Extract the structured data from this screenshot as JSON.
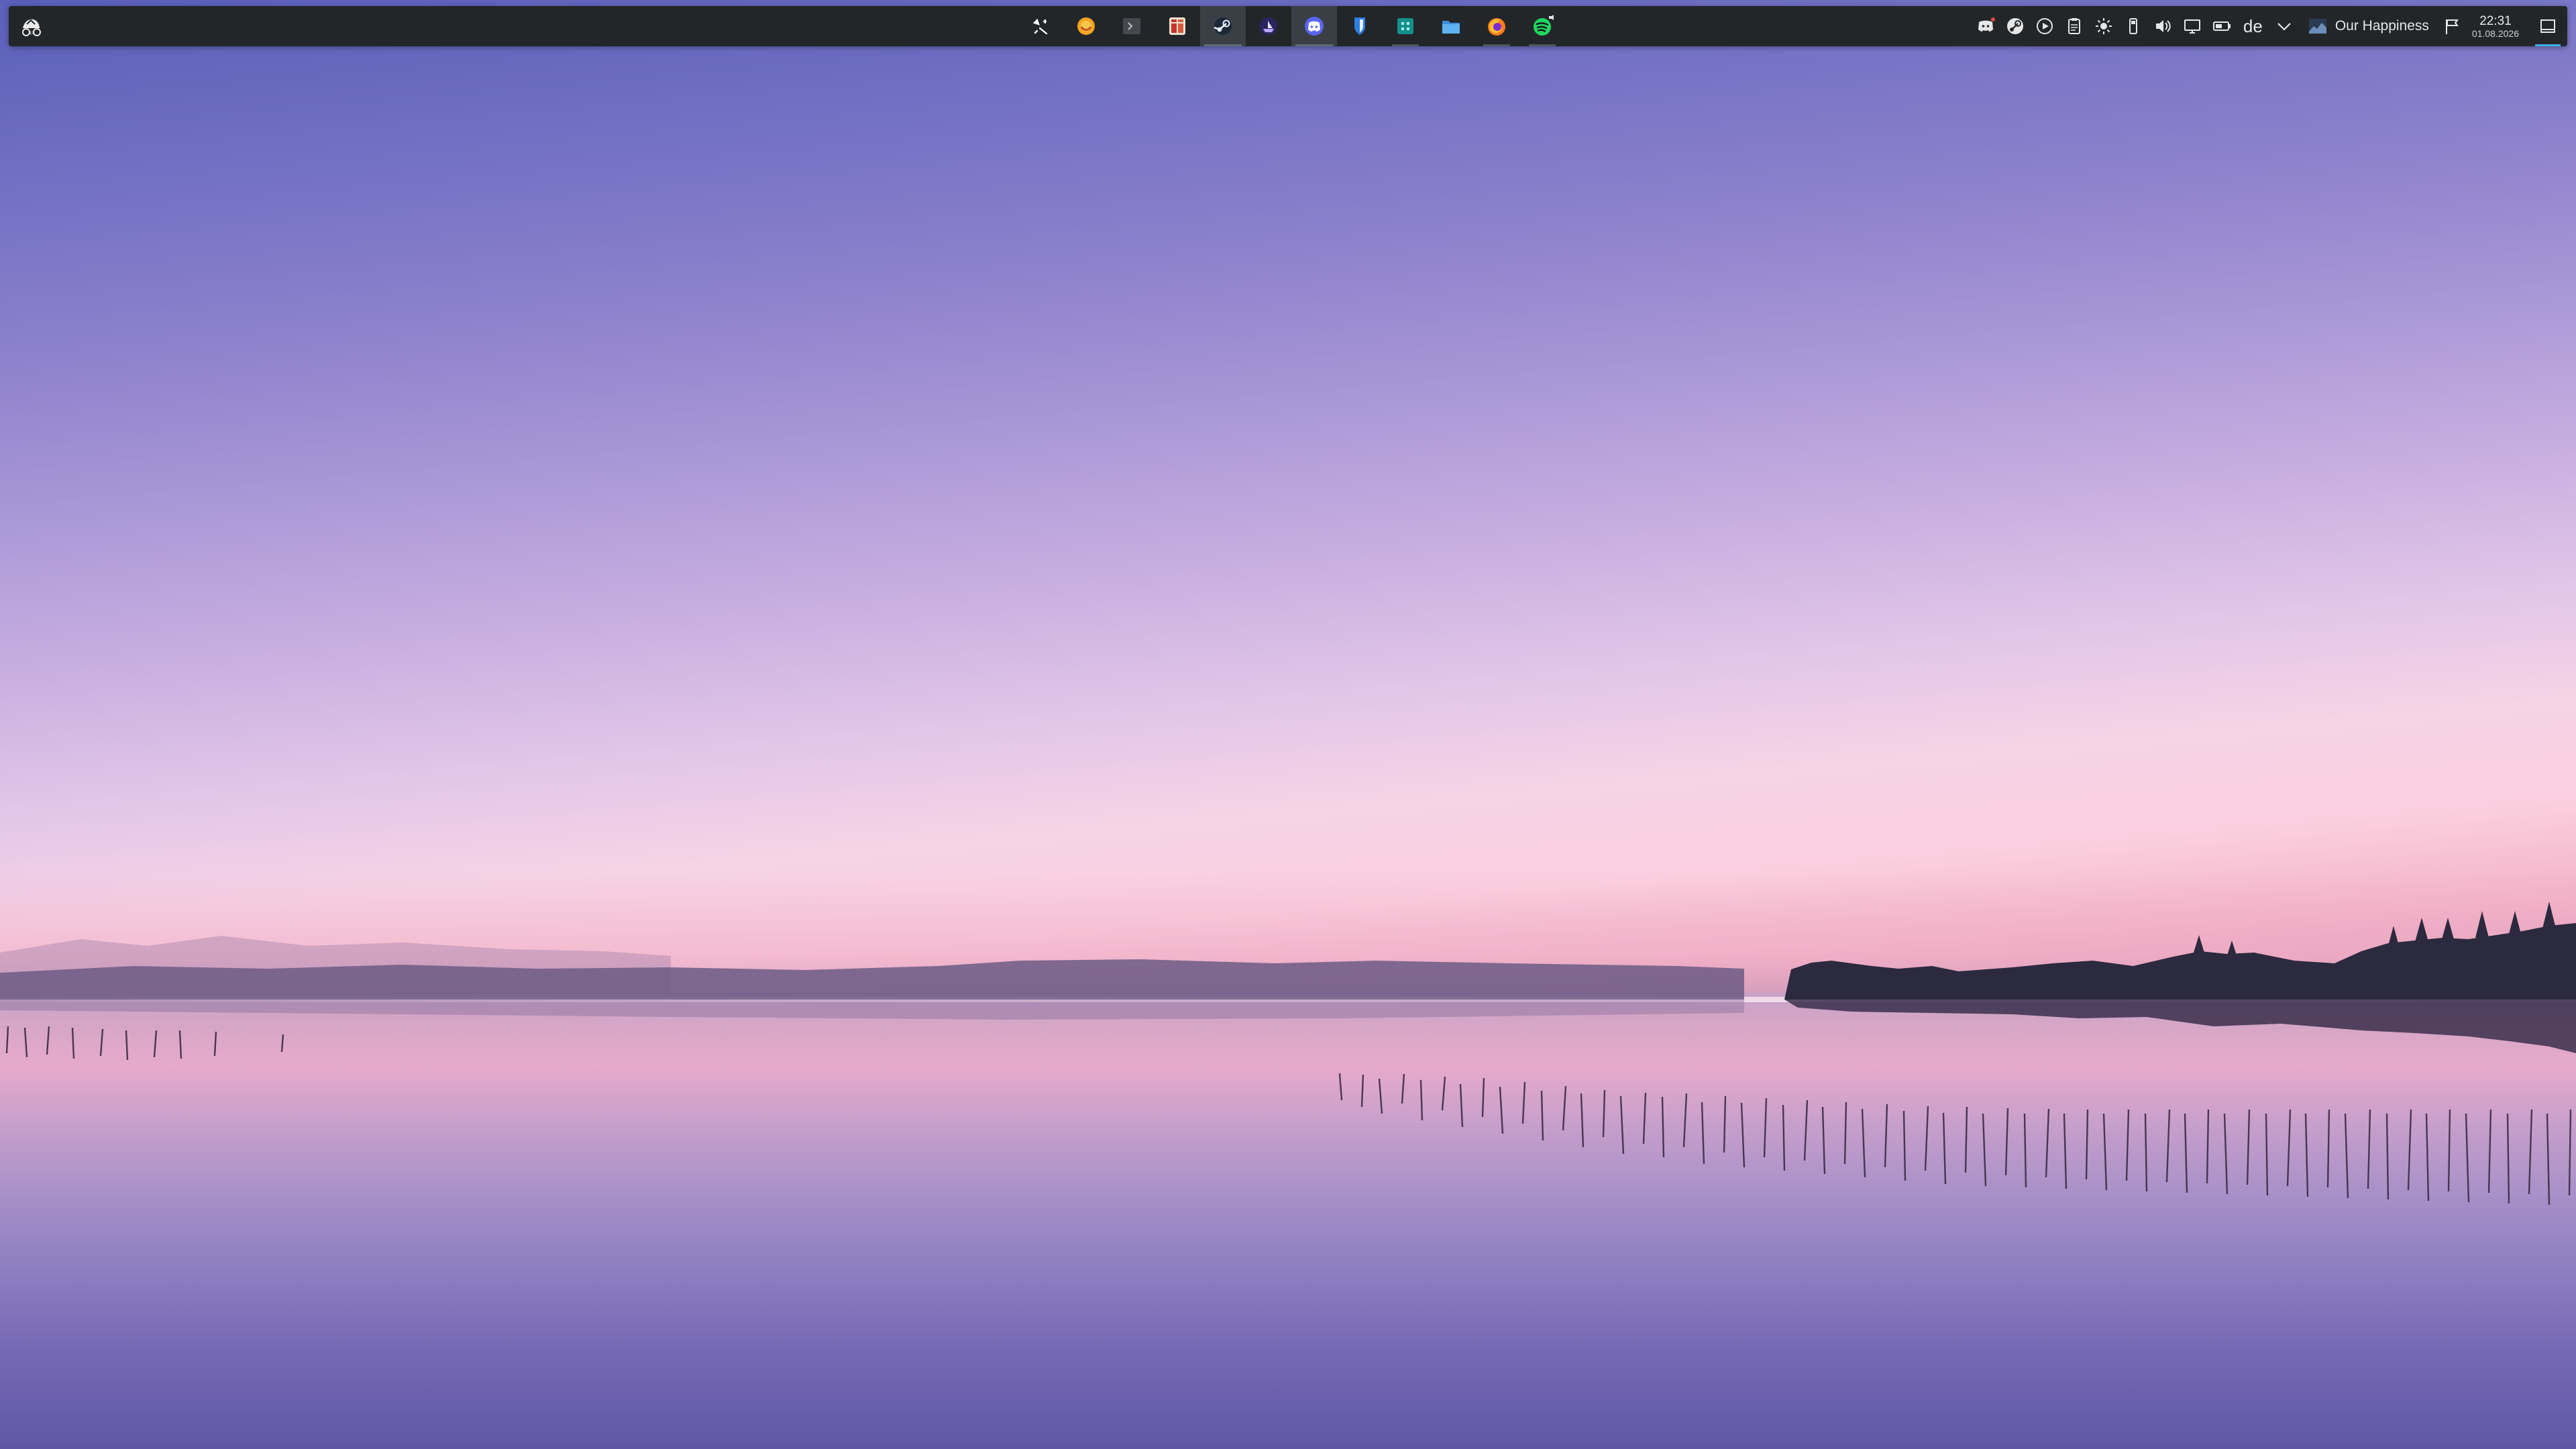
{
  "desktop": {
    "wallpaper_icon": "lake-sunset-wallpaper"
  },
  "panel": {
    "launcher_icon": "application-launcher-icon",
    "tasks": [
      {
        "id": "pin-tool",
        "icon": "color-picker-icon",
        "state": "normal"
      },
      {
        "id": "ubuntu-app",
        "icon": "orange-circle-app-icon",
        "state": "normal"
      },
      {
        "id": "terminal",
        "icon": "terminal-icon",
        "state": "normal"
      },
      {
        "id": "heroic",
        "icon": "game-launcher-icon",
        "state": "normal"
      },
      {
        "id": "steam",
        "icon": "steam-icon",
        "state": "active"
      },
      {
        "id": "proton",
        "icon": "ship-app-icon",
        "state": "normal"
      },
      {
        "id": "discord",
        "icon": "discord-icon",
        "state": "active"
      },
      {
        "id": "bitwarden",
        "icon": "shield-icon",
        "state": "normal"
      },
      {
        "id": "system-monitor",
        "icon": "teal-grid-app-icon",
        "state": "open"
      },
      {
        "id": "file-manager",
        "icon": "folder-icon",
        "state": "normal"
      },
      {
        "id": "firefox",
        "icon": "firefox-icon",
        "state": "open"
      },
      {
        "id": "spotify",
        "icon": "spotify-icon",
        "state": "open"
      }
    ],
    "tray": {
      "language": "de",
      "media_title": "Our Happiness",
      "clock_time": "22:31",
      "clock_date": "01.08.2026"
    },
    "colors": {
      "panel_bg": "#232629",
      "accent": "#3daee9"
    }
  }
}
